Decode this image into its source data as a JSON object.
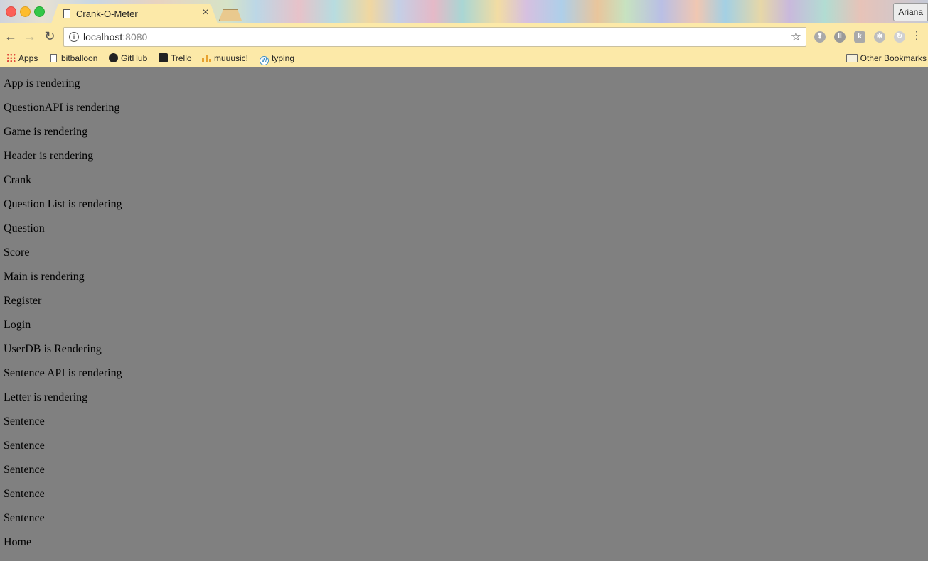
{
  "window": {
    "tab_title": "Crank-O-Meter",
    "profile_name": "Ariana"
  },
  "toolbar": {
    "url_host": "localhost",
    "url_port": ":8080"
  },
  "bookmarks": {
    "items": [
      {
        "label": "Apps",
        "icon": "apps-grid-icon"
      },
      {
        "label": "bitballoon",
        "icon": "page-icon"
      },
      {
        "label": "GitHub",
        "icon": "github-icon"
      },
      {
        "label": "Trello",
        "icon": "trello-icon"
      },
      {
        "label": "muuusic!",
        "icon": "muuusic-icon"
      },
      {
        "label": "typing",
        "icon": "wordpress-icon"
      }
    ],
    "other": "Other Bookmarks"
  },
  "page": {
    "lines": [
      "App is rendering",
      "QuestionAPI is rendering",
      "Game is rendering",
      "Header is rendering",
      "Crank",
      "Question List is rendering",
      "Question",
      "Score",
      "Main is rendering",
      "Register",
      "Login",
      "UserDB is Rendering",
      "Sentence API is rendering",
      "Letter is rendering",
      "Sentence",
      "Sentence",
      "Sentence",
      "Sentence",
      "Sentence",
      "Home"
    ]
  }
}
